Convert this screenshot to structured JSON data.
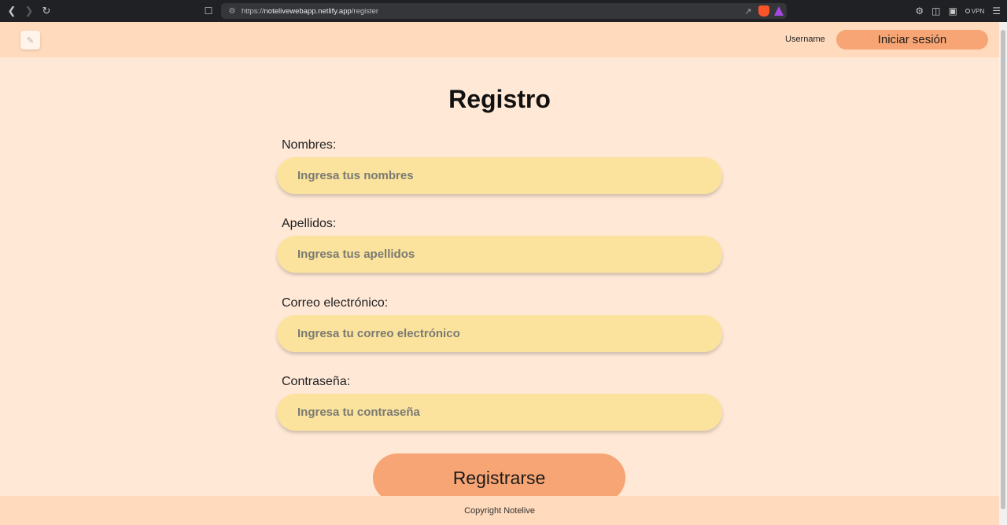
{
  "browser": {
    "url_prefix": "https://",
    "url_domain": "notelivewebapp.netlify.app",
    "url_path": "/register",
    "vpn_label": "VPN"
  },
  "header": {
    "username": "Username",
    "login_label": "Iniciar sesión"
  },
  "form": {
    "title": "Registro",
    "fields": [
      {
        "label": "Nombres:",
        "placeholder": "Ingresa tus nombres"
      },
      {
        "label": "Apellidos:",
        "placeholder": "Ingresa tus apellidos"
      },
      {
        "label": "Correo electrónico:",
        "placeholder": "Ingresa tu correo electrónico"
      },
      {
        "label": "Contraseña:",
        "placeholder": "Ingresa tu contraseña"
      }
    ],
    "submit_label": "Registrarse"
  },
  "footer": {
    "copyright": "Copyright Notelive"
  },
  "colors": {
    "page_bg": "#ffe8d6",
    "header_bg": "#ffdabc",
    "accent": "#f7a574",
    "field_bg": "#fbe39e"
  },
  "icons": [
    "back-icon",
    "forward-icon",
    "reload-icon",
    "bookmark-icon",
    "site-settings-icon",
    "share-icon",
    "brave-shields-icon",
    "brave-rewards-icon",
    "extensions-icon",
    "sidebar-icon",
    "wallet-icon",
    "vpn-icon",
    "menu-icon",
    "app-logo-icon"
  ]
}
